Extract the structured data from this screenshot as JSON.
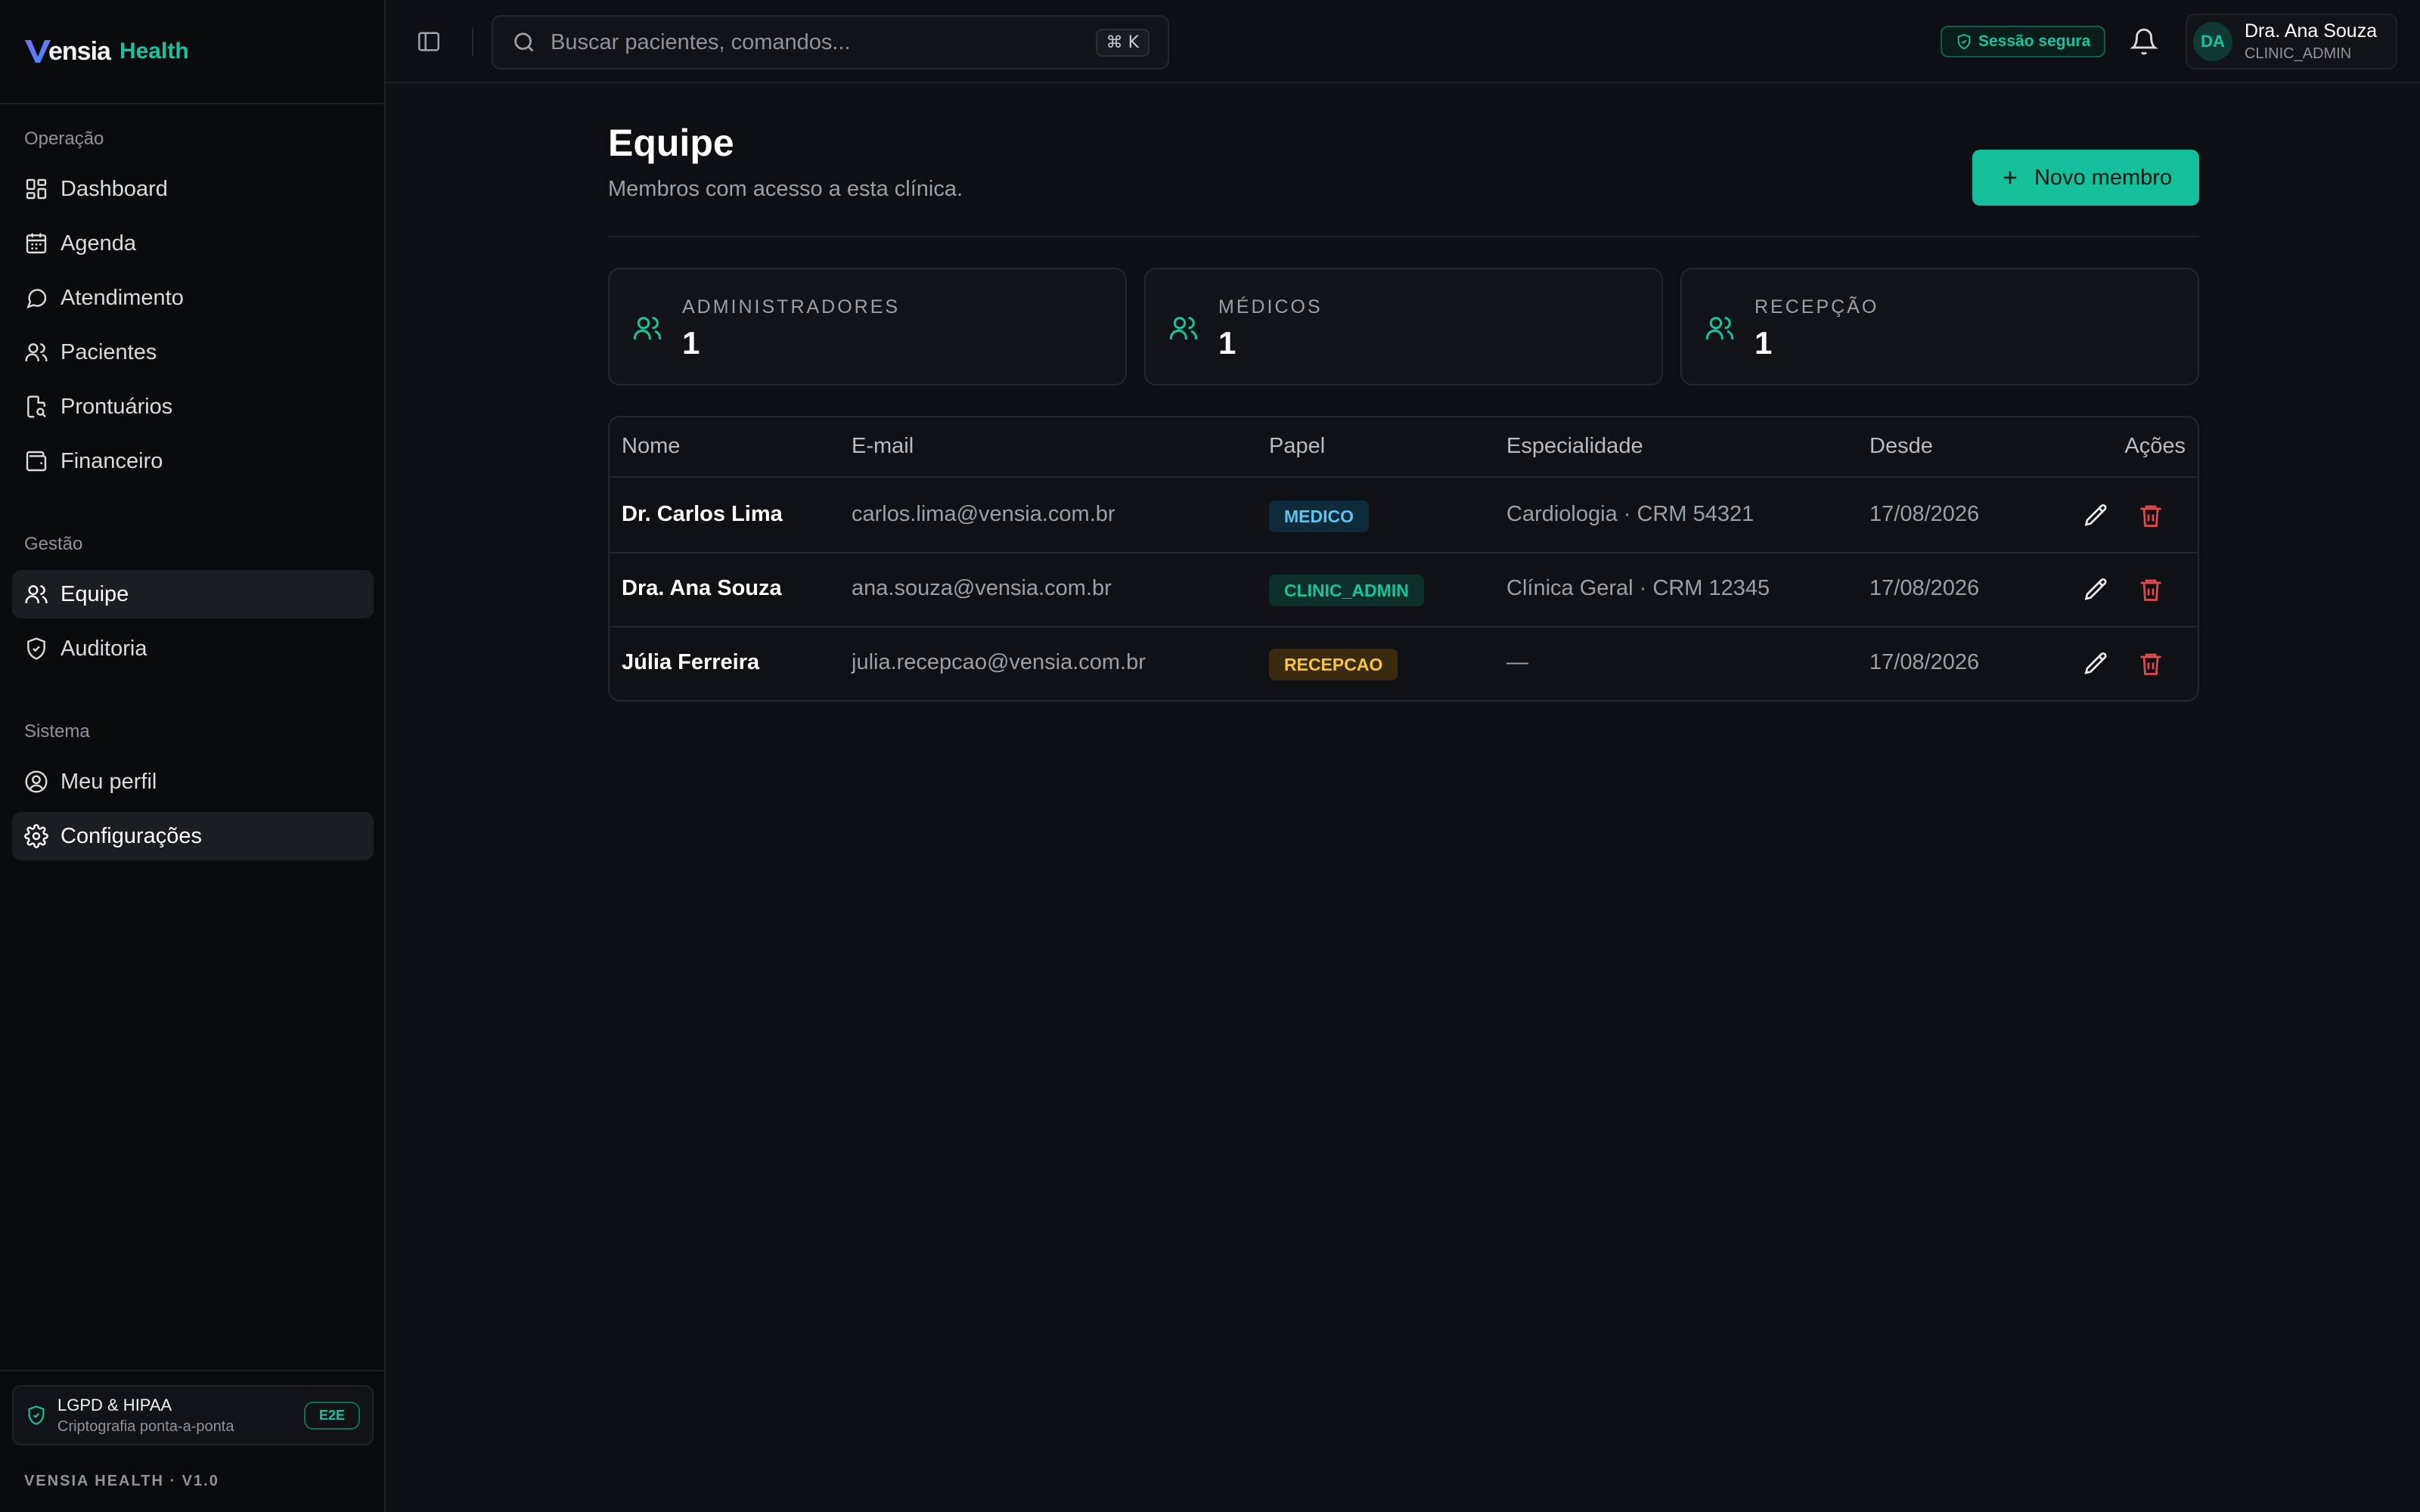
{
  "brand": {
    "name": "ensia",
    "suffix": "Health"
  },
  "sidebar": {
    "sections": [
      {
        "title": "Operação",
        "items": [
          {
            "label": "Dashboard",
            "icon": "dashboard-icon"
          },
          {
            "label": "Agenda",
            "icon": "calendar-icon"
          },
          {
            "label": "Atendimento",
            "icon": "chat-icon"
          },
          {
            "label": "Pacientes",
            "icon": "users-icon"
          },
          {
            "label": "Prontuários",
            "icon": "file-search-icon"
          },
          {
            "label": "Financeiro",
            "icon": "wallet-icon"
          }
        ]
      },
      {
        "title": "Gestão",
        "items": [
          {
            "label": "Equipe",
            "icon": "users-icon",
            "active": true
          },
          {
            "label": "Auditoria",
            "icon": "shield-icon"
          }
        ]
      },
      {
        "title": "Sistema",
        "items": [
          {
            "label": "Meu perfil",
            "icon": "user-circle-icon"
          },
          {
            "label": "Configurações",
            "icon": "gear-icon",
            "active": true
          }
        ]
      }
    ],
    "compliance": {
      "title": "LGPD & HIPAA",
      "subtitle": "Criptografia ponta-a-ponta",
      "badge": "E2E"
    },
    "version": "VENSIA HEALTH · V1.0"
  },
  "topbar": {
    "search_placeholder": "Buscar pacientes, comandos...",
    "shortcut": "⌘ K",
    "secure_label": "Sessão segura",
    "user": {
      "initials": "DA",
      "name": "Dra. Ana Souza",
      "role": "CLINIC_ADMIN"
    }
  },
  "page": {
    "title": "Equipe",
    "subtitle": "Membros com acesso a esta clínica.",
    "new_button": "Novo membro"
  },
  "stats": [
    {
      "label": "ADMINISTRADORES",
      "value": "1"
    },
    {
      "label": "MÉDICOS",
      "value": "1"
    },
    {
      "label": "RECEPÇÃO",
      "value": "1"
    }
  ],
  "table": {
    "columns": [
      "Nome",
      "E-mail",
      "Papel",
      "Especialidade",
      "Desde",
      "Ações"
    ],
    "rows": [
      {
        "name": "Dr. Carlos Lima",
        "email": "carlos.lima@vensia.com.br",
        "role": "MEDICO",
        "specialty": "Cardiologia · CRM 54321",
        "since": "17/08/2026"
      },
      {
        "name": "Dra. Ana Souza",
        "email": "ana.souza@vensia.com.br",
        "role": "CLINIC_ADMIN",
        "specialty": "Clínica Geral · CRM 12345",
        "since": "17/08/2026"
      },
      {
        "name": "Júlia Ferreira",
        "email": "julia.recepcao@vensia.com.br",
        "role": "RECEPCAO",
        "specialty": "—",
        "since": "17/08/2026"
      }
    ]
  },
  "colors": {
    "accent": "#14bf9c",
    "role_medico": "#5ec4f0",
    "role_admin": "#16c4a0",
    "role_recepcao": "#f5c542",
    "danger": "#e5484d"
  }
}
